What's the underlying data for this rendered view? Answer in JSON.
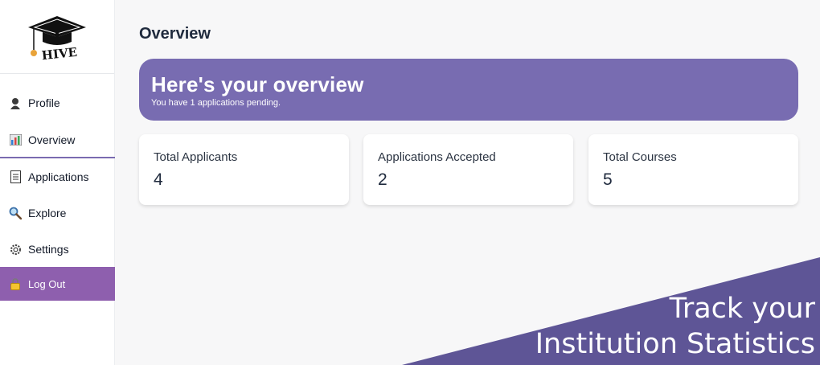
{
  "brand": {
    "logo_text": "HIVE"
  },
  "sidebar": {
    "items": [
      {
        "label": "Profile",
        "icon": "user-icon"
      },
      {
        "label": "Overview",
        "icon": "bar-chart-icon"
      },
      {
        "label": "Applications",
        "icon": "document-icon"
      },
      {
        "label": "Explore",
        "icon": "magnifier-icon"
      },
      {
        "label": "Settings",
        "icon": "gear-icon"
      },
      {
        "label": "Log Out",
        "icon": "lock-icon"
      }
    ]
  },
  "main": {
    "title": "Overview",
    "banner": {
      "title": "Here's your overview",
      "subtitle": "You have 1 applications pending."
    },
    "cards": [
      {
        "label": "Total Applicants",
        "value": "4"
      },
      {
        "label": "Applications Accepted",
        "value": "2"
      },
      {
        "label": "Total Courses",
        "value": "5"
      }
    ]
  },
  "promo": {
    "line1": "Track your",
    "line2": "Institution Statistics"
  },
  "colors": {
    "accent": "#786cb1",
    "logout": "#8e5fae",
    "promo": "#5e5596"
  }
}
